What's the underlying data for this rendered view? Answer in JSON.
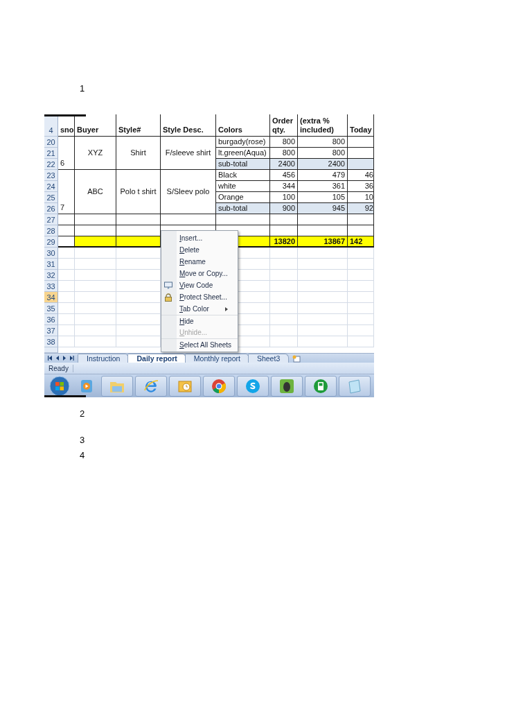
{
  "markers_before": [
    "1"
  ],
  "spreadsheet": {
    "header": {
      "row": "4",
      "cells": [
        "sno",
        "Buyer",
        "Style#",
        "Style Desc.",
        "Colors",
        "Order qty.",
        "(extra % included)",
        "Today"
      ]
    },
    "groups": [
      {
        "sno": "6",
        "buyer": "XYZ",
        "style": "Shirt",
        "desc": "F/sleeve shirt",
        "lines": [
          {
            "row": "20",
            "kind": "item",
            "color_name": "burgady(rose)",
            "order_qty": "800",
            "extra": "800"
          },
          {
            "row": "21",
            "kind": "item",
            "color_name": "lt.green(Aqua)",
            "order_qty": "800",
            "extra": "800"
          },
          {
            "row": "22",
            "kind": "subtotal",
            "color_name": "sub-total",
            "order_qty": "2400",
            "extra": "2400"
          }
        ]
      },
      {
        "sno": "7",
        "buyer": "ABC",
        "style": "Polo t shirt",
        "desc": "S/Sleev polo",
        "lines": [
          {
            "row": "23",
            "kind": "item",
            "color_name": "Black",
            "order_qty": "456",
            "extra": "479",
            "today": "46"
          },
          {
            "row": "24",
            "kind": "item",
            "color_name": "white",
            "order_qty": "344",
            "extra": "361",
            "today": "36"
          },
          {
            "row": "25",
            "kind": "item",
            "color_name": "Orange",
            "order_qty": "100",
            "extra": "105",
            "today": "10"
          },
          {
            "row": "26",
            "kind": "subtotal",
            "color_name": "sub-total",
            "order_qty": "900",
            "extra": "945",
            "today": "92"
          }
        ]
      }
    ],
    "empty_rows": [
      "27",
      "28"
    ],
    "total": {
      "row": "29",
      "order_qty": "13820",
      "extra": "13867",
      "today": "142"
    },
    "blank_rows": [
      {
        "row": "30",
        "selected": false
      },
      {
        "row": "31",
        "selected": false
      },
      {
        "row": "32",
        "selected": false
      },
      {
        "row": "33",
        "selected": false
      },
      {
        "row": "34",
        "selected": true
      },
      {
        "row": "35",
        "selected": false
      },
      {
        "row": "36",
        "selected": false
      },
      {
        "row": "37",
        "selected": false
      },
      {
        "row": "38",
        "selected": false
      }
    ],
    "sheet_tabs": [
      {
        "label": "Instruction",
        "selected": false
      },
      {
        "label": "Daily report",
        "selected": true
      },
      {
        "label": "Monthly report",
        "selected": false
      },
      {
        "label": "Sheet3",
        "selected": false
      }
    ],
    "status": "Ready",
    "context_menu": [
      {
        "label": "Insert...",
        "kind": "plain",
        "disabled": false,
        "separator_before": false
      },
      {
        "label": "Delete",
        "kind": "plain",
        "disabled": false,
        "separator_before": false
      },
      {
        "label": "Rename",
        "kind": "plain",
        "disabled": false,
        "separator_before": false
      },
      {
        "label": "Move or Copy...",
        "kind": "plain",
        "disabled": false,
        "separator_before": false
      },
      {
        "label": "View Code",
        "kind": "with-icon",
        "disabled": false,
        "separator_before": false
      },
      {
        "label": "Protect Sheet...",
        "kind": "with-icon",
        "disabled": false,
        "separator_before": false
      },
      {
        "label": "Tab Color",
        "kind": "submenu",
        "disabled": false,
        "separator_before": false
      },
      {
        "label": "Hide",
        "kind": "plain",
        "disabled": false,
        "separator_before": true
      },
      {
        "label": "Unhide...",
        "kind": "plain",
        "disabled": true,
        "separator_before": false
      },
      {
        "label": "Select All Sheets",
        "kind": "plain",
        "disabled": false,
        "separator_before": true
      }
    ]
  },
  "markers_after": [
    "2",
    "3",
    "4"
  ]
}
